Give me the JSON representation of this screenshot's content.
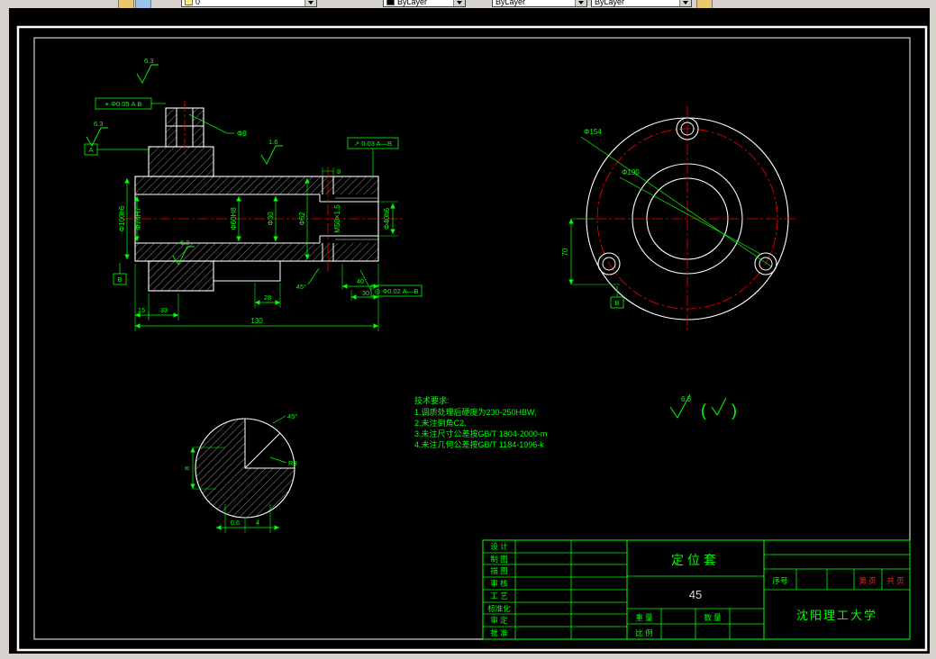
{
  "toolbar": {
    "layer_value": "0",
    "color_value": "ByLayer",
    "linetype_value": "ByLayer",
    "lineweight_value": "ByLayer"
  },
  "section_view": {
    "roughness": {
      "r1": "6.3",
      "r2": "6.3",
      "r3": "1.6",
      "r4": "6.3"
    },
    "gdt": {
      "frame1": "⌖ Φ0.05 A B",
      "frame2": "↗ 0.03 A—B",
      "frame3": "◎ Φ0.02 A—B",
      "datum_a": "A",
      "datum_b": "B"
    },
    "dims": {
      "hole_label": "Φ9",
      "hole_width": "8",
      "outer_dia": "Φ100h6",
      "bore_dia": "Φ74H7",
      "mid_dia1": "Φ60H8",
      "mid_dia2": "Φ30",
      "mid_dia3": "Φ62",
      "thread": "M50×1.5",
      "end_dia": "Φ40h6",
      "len1": "15",
      "len2": "33",
      "len_total": "130",
      "len3": "28",
      "len4": "40",
      "len5": "30",
      "chamfer": "45°"
    }
  },
  "flange_view": {
    "dims": {
      "bolt_circle": "Φ154",
      "outer_dia": "Φ190",
      "height": "70"
    },
    "datum": "B"
  },
  "detail_view": {
    "dims": {
      "angle": "45°",
      "radius": "R3",
      "width": "0.6",
      "len": "4",
      "depth": "8"
    }
  },
  "notes": {
    "title": "技术要求:",
    "items": [
      "1.调质处理后硬度为230-250HBW,",
      "2.未注倒角C2.",
      "3.未注尺寸公差按GB/T 1804-2000-m",
      "4.未注几何公差按GB/T 1184-1996-k"
    ]
  },
  "general_roughness": {
    "value": "6.3",
    "paren_open": "(",
    "paren_close": ")"
  },
  "title_block": {
    "rows": [
      "设 计",
      "制 图",
      "描 图",
      "审 核",
      "工 艺",
      "标准化",
      "审 定",
      "批 准"
    ],
    "part_name": "定位套",
    "material": "45",
    "serial_label": "序号",
    "sheet_no": "第 页",
    "sheet_total": "共 页",
    "university": "沈阳理工大学",
    "weight": "重 量",
    "quantity": "数 量",
    "scale": "比 例"
  }
}
